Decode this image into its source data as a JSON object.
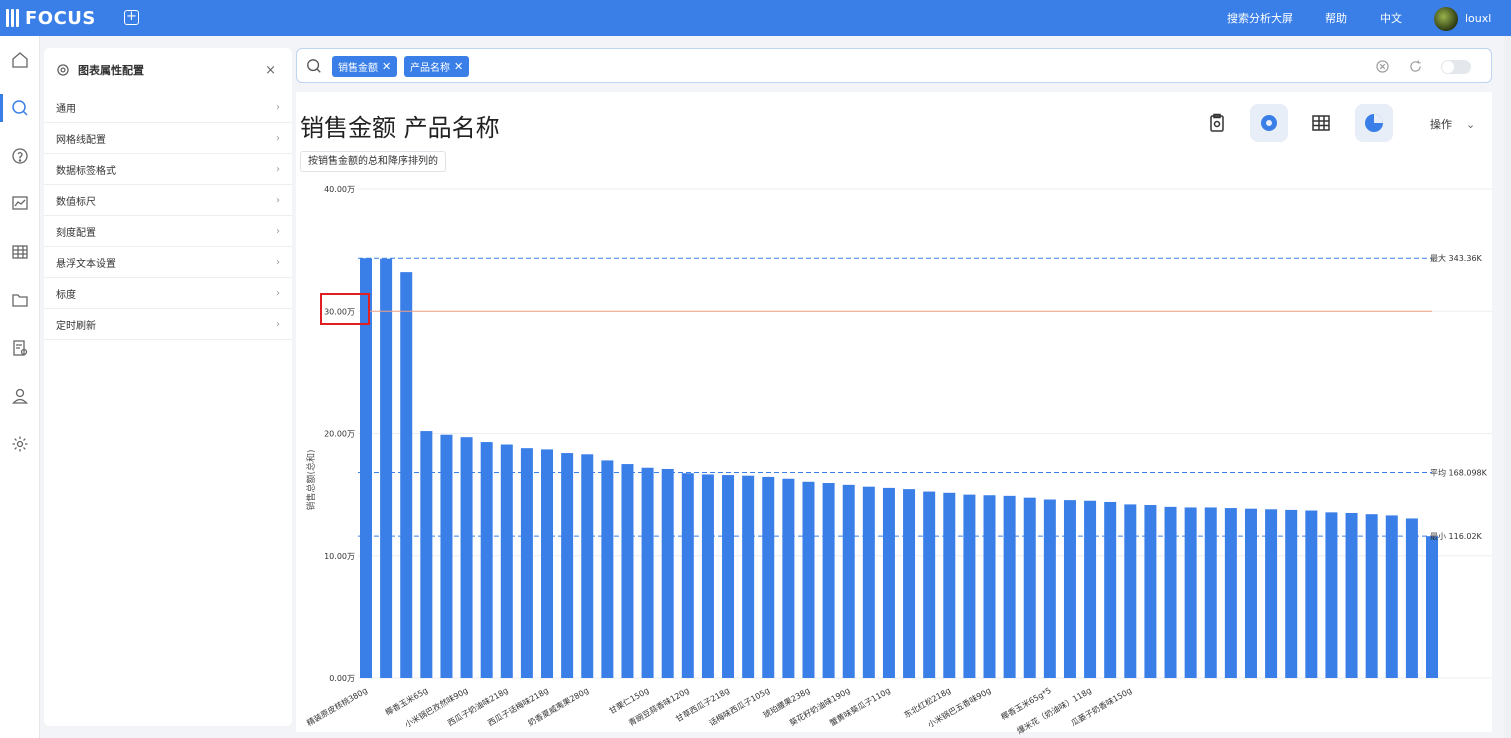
{
  "app": {
    "logo": "FOCUS",
    "new_tab": "+"
  },
  "topbar": {
    "links": [
      "搜索分析大屏",
      "帮助",
      "中文"
    ],
    "user": "louxl"
  },
  "sidenav": {
    "icons": [
      "home-icon",
      "search-icon",
      "help-icon",
      "dashboard-icon",
      "table-icon",
      "folder-icon",
      "report-settings-icon",
      "user-icon",
      "settings-icon"
    ]
  },
  "panel": {
    "title": "图表属性配置",
    "close": "×",
    "items": [
      "通用",
      "网格线配置",
      "数据标签格式",
      "数值标尺",
      "刻度配置",
      "悬浮文本设置",
      "标度",
      "定时刷新"
    ]
  },
  "search": {
    "chips": [
      "销售金额",
      "产品名称"
    ]
  },
  "main": {
    "title": "销售金额 产品名称",
    "sort_tag": "按销售金额的总和降序排列的",
    "ops": "操作"
  },
  "colors": {
    "accent": "#3a7fe8",
    "bar": "#3a7fe8",
    "target_line": "#f0a080",
    "highlight": "#e02020"
  },
  "chart_data": {
    "type": "bar",
    "ylabel": "销售总额(总和)",
    "ylim": [
      0,
      400000
    ],
    "yticks": [
      "0.00万",
      "10.00万",
      "20.00万",
      "30.00万",
      "40.00万"
    ],
    "grid": true,
    "reference_lines": [
      {
        "label": "最大 343.36K",
        "value": 343360,
        "style": "dashed"
      },
      {
        "label": "平均 168.098K",
        "value": 168098,
        "style": "dashed"
      },
      {
        "label": "最小 116.02K",
        "value": 116020,
        "style": "dashed"
      },
      {
        "label": "",
        "value": 300000,
        "style": "solid"
      }
    ],
    "categories": [
      "精装原皮核桃380g",
      "",
      "",
      "椰香玉米65g",
      "",
      "小米锅巴孜然味90g",
      "",
      "西瓜子奶油味218g",
      "",
      "西瓜子话梅味218g",
      "",
      "奶香夏威夷果280g",
      "",
      "",
      "甘栗仁150g",
      "",
      "青豌豆蒜香味120g",
      "",
      "甘草西瓜子218g",
      "",
      "话梅味西瓜子105g",
      "",
      "琥珀腰果238g",
      "",
      "葵花籽奶油味190g",
      "",
      "蟹黄味葵瓜子110g",
      "",
      "",
      "东北红松218g",
      "",
      "小米锅巴五香味90g",
      "",
      "",
      "椰香玉米65g*5",
      "",
      "爆米花（奶油味）118g",
      "",
      "瓜蒌子奶香味150g",
      "",
      "",
      "",
      "",
      "",
      "",
      "",
      "",
      "",
      "",
      "",
      "",
      "",
      "",
      "",
      ""
    ],
    "values": [
      343360,
      343000,
      332000,
      202000,
      199000,
      197000,
      193000,
      191000,
      188000,
      187000,
      184000,
      183000,
      178000,
      175000,
      172000,
      171000,
      167500,
      166500,
      166000,
      165500,
      164500,
      163000,
      160500,
      159500,
      158000,
      156500,
      155500,
      154500,
      152500,
      151500,
      150000,
      149500,
      149000,
      147500,
      146000,
      145500,
      145000,
      144000,
      142000,
      141500,
      140000,
      139500,
      139500,
      139000,
      138500,
      138000,
      137500,
      137000,
      135500,
      135000,
      134000,
      133000,
      130500,
      116020
    ]
  }
}
